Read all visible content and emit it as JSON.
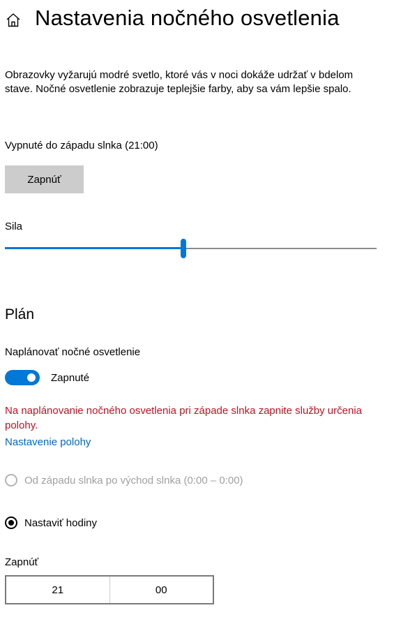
{
  "header": {
    "icon": "home-icon",
    "title": "Nastavenia nočného osvetlenia"
  },
  "description": "Obrazovky vyžarujú modré svetlo, ktoré vás v noci dokáže udržať v bdelom stave. Nočné osvetlenie zobrazuje teplejšie farby, aby sa vám lepšie spalo.",
  "status": "Vypnuté do západu slnka (21:00)",
  "turn_on_button": "Zapnúť",
  "strength": {
    "label": "Sila",
    "value_fraction": 0.48
  },
  "schedule": {
    "heading": "Plán",
    "label": "Naplánovať nočné osvetlenie",
    "toggle_state": "Zapnuté",
    "toggle_on": true,
    "warning": "Na naplánovanie nočného osvetlenia pri západe slnka zapnite služby určenia polohy.",
    "location_link": "Nastavenie polohy",
    "option_sunset": "Od západu slnka po východ slnka (0:00 – 0:00)",
    "option_set_hours": "Nastaviť hodiny",
    "selected_option": "set_hours",
    "on_label": "Zapnúť",
    "on_hour": "21",
    "on_minute": "00"
  },
  "colors": {
    "accent": "#0078d7",
    "warning": "#c50f1f",
    "link": "#0067c0",
    "button_bg": "#cccccc"
  }
}
